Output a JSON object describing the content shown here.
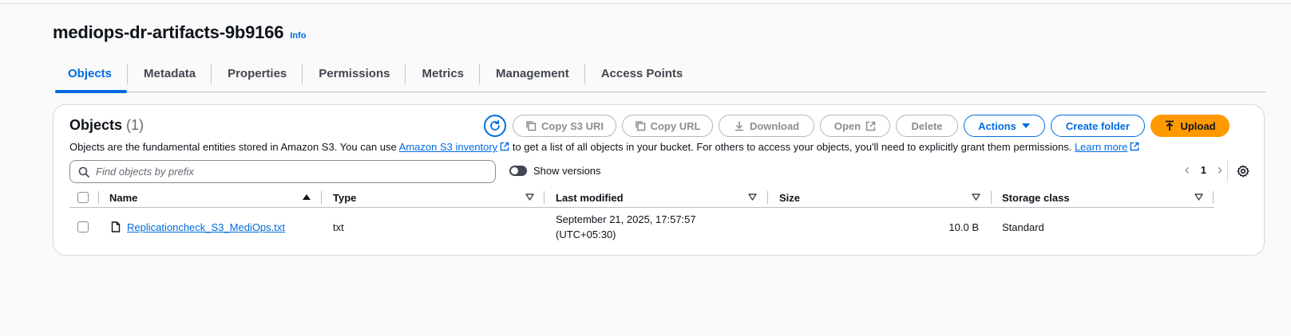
{
  "bucket": {
    "name": "mediops-dr-artifacts-9b9166",
    "info_label": "Info"
  },
  "tabs": [
    {
      "label": "Objects",
      "active": true
    },
    {
      "label": "Metadata"
    },
    {
      "label": "Properties"
    },
    {
      "label": "Permissions"
    },
    {
      "label": "Metrics"
    },
    {
      "label": "Management"
    },
    {
      "label": "Access Points"
    }
  ],
  "objects_panel": {
    "title": "Objects",
    "count": "(1)",
    "description_prefix": "Objects are the fundamental entities stored in Amazon S3. You can use ",
    "inventory_link": "Amazon S3 inventory",
    "description_middle": " to get a list of all objects in your bucket. For others to access your objects, you'll need to explicitly grant them permissions. ",
    "learn_more": "Learn more"
  },
  "toolbar": {
    "copy_s3_uri": "Copy S3 URI",
    "copy_url": "Copy URL",
    "download": "Download",
    "open": "Open",
    "delete": "Delete",
    "actions": "Actions",
    "create_folder": "Create folder",
    "upload": "Upload"
  },
  "search": {
    "placeholder": "Find objects by prefix"
  },
  "show_versions": {
    "label": "Show versions",
    "enabled": false
  },
  "pagination": {
    "current_page": "1"
  },
  "table": {
    "columns": [
      "Name",
      "Type",
      "Last modified",
      "Size",
      "Storage class"
    ],
    "rows": [
      {
        "name": "Replicationcheck_S3_MediOps.txt",
        "type": "txt",
        "last_modified_date": "September 21, 2025, 17:57:57",
        "last_modified_tz": "(UTC+05:30)",
        "size": "10.0 B",
        "storage_class": "Standard"
      }
    ]
  },
  "colors": {
    "link": "#006ce0",
    "primary_button": "#ff9900",
    "disabled_text": "#8c8c94"
  }
}
